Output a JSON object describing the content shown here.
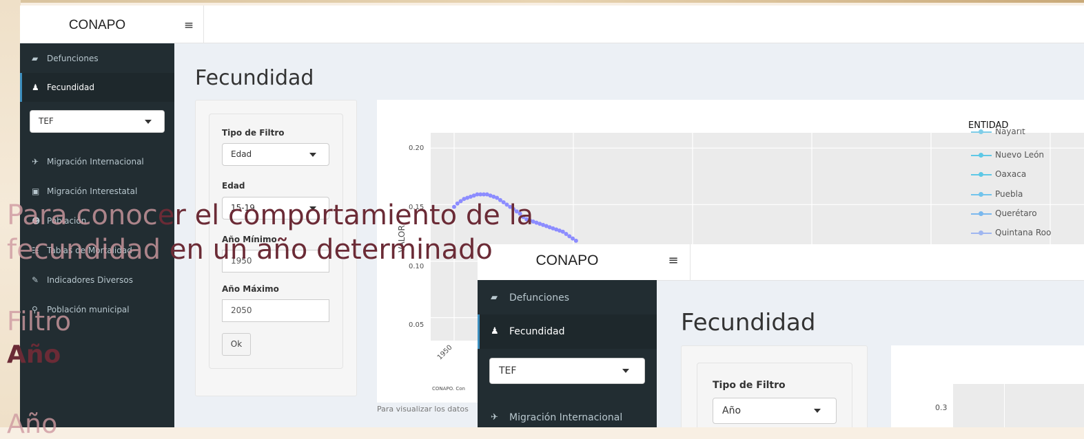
{
  "front_app": {
    "logo": "CONAPO",
    "hamburger_icon": "≡",
    "menu": [
      {
        "icon": "book-icon",
        "glyph": "▰",
        "label": "Defunciones"
      },
      {
        "icon": "child-icon",
        "glyph": "♟",
        "label": "Fecundidad"
      },
      {
        "icon": "plane-icon",
        "glyph": "✈",
        "label": "Migración Internacional"
      },
      {
        "icon": "bus-icon",
        "glyph": "▣",
        "label": "Migración Interestatal"
      },
      {
        "icon": "users-icon",
        "glyph": "☻",
        "label": "Población"
      },
      {
        "icon": "table-icon",
        "glyph": "☷",
        "label": "Tablas de Mortalidad"
      },
      {
        "icon": "edit-icon",
        "glyph": "✎",
        "label": "Indicadores Diversos"
      },
      {
        "icon": "search-icon",
        "glyph": "⚲",
        "label": "Población municipal"
      }
    ],
    "indicator_select": "TEF",
    "page_title": "Fecundidad",
    "filters": {
      "tipo_label": "Tipo de Filtro",
      "tipo_value": "Edad",
      "edad_label": "Edad",
      "edad_value": "15-19",
      "min_label": "Año Mínimo",
      "min_value": "1950",
      "max_label": "Año Máximo",
      "max_value": "2050",
      "ok": "Ok"
    },
    "plot_footnote": "Para visualizar los datos"
  },
  "back_app": {
    "logo": "CONAPO",
    "hamburger_icon": "≡",
    "menu": [
      {
        "icon": "book-icon",
        "glyph": "▰",
        "label": "Defunciones"
      },
      {
        "icon": "child-icon",
        "glyph": "♟",
        "label": "Fecundidad"
      },
      {
        "icon": "plane-icon",
        "glyph": "✈",
        "label": "Migración Internacional"
      }
    ],
    "indicator_select": "TEF",
    "page_title": "Fecundidad",
    "filters": {
      "tipo_label": "Tipo de Filtro",
      "tipo_value": "Año"
    }
  },
  "chart_data": [
    {
      "type": "line",
      "ylabel": "VALOR",
      "y_ticks": [
        "0.20",
        "0.15",
        "0.10",
        "0.05"
      ],
      "x_ticks": [
        "1950"
      ],
      "caption": "CONAPO. Con",
      "legend_title": "ENTIDAD",
      "legend_items": [
        "Nayarit",
        "Nuevo León",
        "Oaxaca",
        "Puebla",
        "Querétaro",
        "Quintana Roo"
      ],
      "series_color": "#8c8cff",
      "series": [
        {
          "x": [
            1950,
            1951,
            1952,
            1953,
            1954,
            1955,
            1956,
            1957,
            1958,
            1959,
            1960,
            1961,
            1962,
            1963,
            1964,
            1965,
            1966,
            1967,
            1968,
            1969,
            1970,
            1971,
            1972,
            1973,
            1974,
            1975,
            1976,
            1977,
            1978,
            1979,
            1980,
            1981,
            1982,
            1983,
            1984,
            1985,
            1986,
            1987
          ],
          "values": [
            0.148,
            0.151,
            0.153,
            0.155,
            0.156,
            0.157,
            0.158,
            0.159,
            0.159,
            0.159,
            0.159,
            0.158,
            0.157,
            0.156,
            0.154,
            0.152,
            0.15,
            0.148,
            0.146,
            0.144,
            0.142,
            0.139,
            0.137,
            0.136,
            0.135,
            0.134,
            0.133,
            0.132,
            0.131,
            0.13,
            0.129,
            0.128,
            0.127,
            0.126,
            0.124,
            0.122,
            0.12,
            0.118
          ]
        }
      ]
    },
    {
      "type": "line",
      "y_ticks": [
        "0.3"
      ]
    }
  ],
  "overlay": {
    "line1_ghost": "Para conoc",
    "line1_text": "er el comportamiento de la",
    "line2_ghost": "fecundidad",
    "line2_text": " en un año determinado",
    "filtro": "Filtro",
    "anio": "Año",
    "anio_bottom": "Año"
  }
}
